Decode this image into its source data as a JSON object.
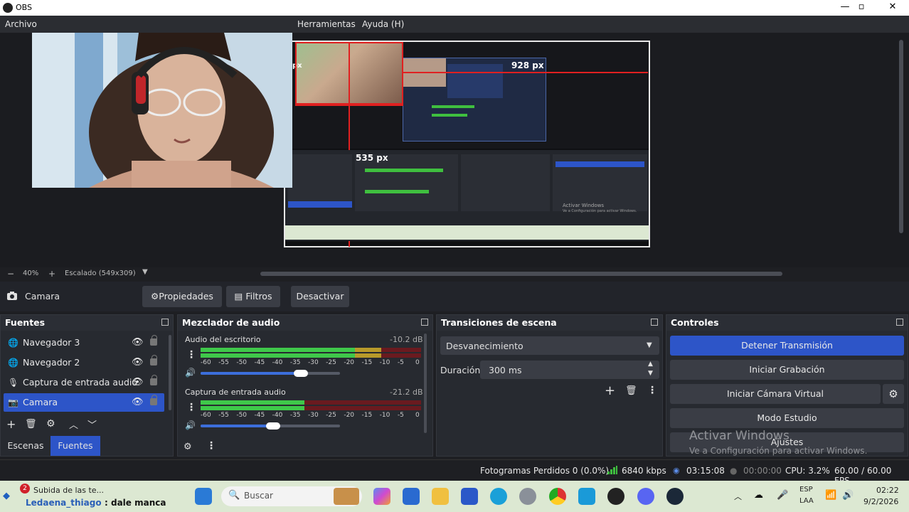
{
  "window": {
    "title": "OBS",
    "controls": {
      "minimize": "—",
      "maximize": "▫",
      "close": "✕"
    }
  },
  "menu": {
    "archivo": "Archivo",
    "herramientas": "Herramientas",
    "ayuda": "Ayuda (H)"
  },
  "preview": {
    "overlay_px_top": "928 px",
    "overlay_px_left": "535 px",
    "overlay_px_small": "px",
    "inner_watermark_line1": "Activar Windows",
    "inner_watermark_line2": "Ve a Configuración para activar Windows."
  },
  "scale_bar": {
    "zoom": "40%",
    "minus": "−",
    "plus": "+",
    "scaled": "Escalado (549x309)"
  },
  "source_toolbar": {
    "selected_source": "Camara",
    "properties": "Propiedades",
    "filters": "Filtros",
    "deactivate": "Desactivar"
  },
  "sources": {
    "title": "Fuentes",
    "items": [
      {
        "label": "Navegador 3",
        "icon": "globe-icon"
      },
      {
        "label": "Navegador 2",
        "icon": "globe-icon"
      },
      {
        "label": "Captura de entrada audio",
        "icon": "microphone-icon"
      },
      {
        "label": "Camara",
        "icon": "camera-icon"
      }
    ],
    "selected_index": 3,
    "tabs": {
      "scenes": "Escenas",
      "sources": "Fuentes"
    }
  },
  "mixer": {
    "title": "Mezclador de audio",
    "channels": [
      {
        "name": "Audio del escritorio",
        "db": "-10.2 dB",
        "level": 0.82,
        "volume": 0.72
      },
      {
        "name": "Captura de entrada audio",
        "db": "-21.2 dB",
        "level": 0.47,
        "volume": 0.52
      }
    ],
    "ticks": [
      "-60",
      "-55",
      "-50",
      "-45",
      "-40",
      "-35",
      "-30",
      "-25",
      "-20",
      "-15",
      "-10",
      "-5",
      "0"
    ]
  },
  "transitions": {
    "title": "Transiciones de escena",
    "selected": "Desvanecimiento",
    "duration_label": "Duración",
    "duration_value": "300 ms"
  },
  "controls": {
    "title": "Controles",
    "stop_stream": "Detener Transmisión",
    "start_recording": "Iniciar Grabación",
    "start_virtual_cam": "Iniciar Cámara Virtual",
    "studio_mode": "Modo Estudio",
    "settings": "Ajustes",
    "watermark_line1": "Activar Windows",
    "watermark_line2": "Ve a Configuración para activar Windows.",
    "accent": "#2d55c8"
  },
  "status": {
    "dropped": "Fotogramas Perdidos 0 (0.0%)",
    "bitrate": "6840 kbps",
    "stream_time": "03:15:08",
    "rec_time": "00:00:00",
    "cpu": "CPU: 3.2%",
    "fps": "60.00 / 60.00 FPS"
  },
  "taskbar": {
    "notification_badge": "2",
    "notification_line1": "Subida de las te...",
    "notification_user": "Ledaena_thiago",
    "notification_msg": ": dale manca",
    "search_placeholder": "Buscar",
    "lang_line1": "ESP",
    "lang_line2": "LAA",
    "time": "02:22",
    "date": "9/2/2026"
  }
}
